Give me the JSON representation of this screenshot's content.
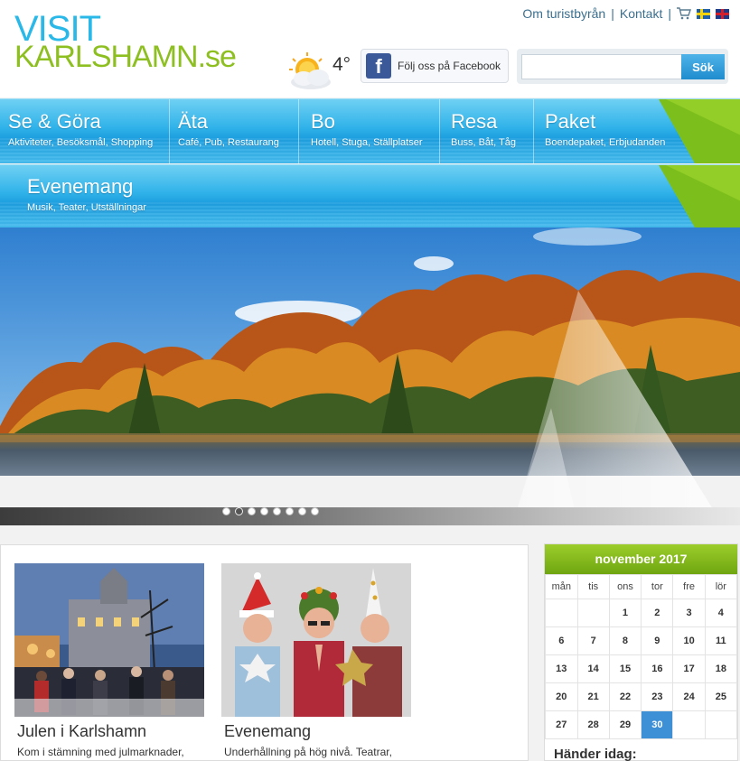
{
  "header": {
    "logo_line1": "VISIT",
    "logo_line2": "KARLSHAMN",
    "logo_tld": ".se",
    "links": [
      "Om turistbyrån",
      "Kontakt"
    ],
    "separator": "|",
    "temperature": "4°",
    "facebook_label": "Följ oss på Facebook",
    "facebook_letter": "f",
    "search_placeholder": "",
    "search_button": "Sök"
  },
  "nav": {
    "row1": [
      {
        "title": "Se & Göra",
        "sub": "Aktiviteter, Besöksmål, Shopping"
      },
      {
        "title": "Äta",
        "sub": "Café, Pub, Restaurang"
      },
      {
        "title": "Bo",
        "sub": "Hotell, Stuga, Ställplatser"
      },
      {
        "title": "Resa",
        "sub": "Buss, Båt, Tåg"
      },
      {
        "title": "Paket",
        "sub": "Boendepaket, Erbjudanden"
      }
    ],
    "row2": [
      {
        "title": "Evenemang",
        "sub": "Musik, Teater, Utställningar"
      }
    ]
  },
  "slider": {
    "dot_count": 8,
    "active_dot": 2
  },
  "cards": [
    {
      "title": "Julen i Karlshamn",
      "text": "Kom i stämning med julmarknader,"
    },
    {
      "title": "Evenemang",
      "text": "Underhållning på hög nivå. Teatrar,"
    }
  ],
  "calendar": {
    "month": "november 2017",
    "weekdays": [
      "mån",
      "tis",
      "ons",
      "tor",
      "fre",
      "lör"
    ],
    "weeks": [
      [
        "",
        "",
        "1",
        "2",
        "3",
        "4"
      ],
      [
        "6",
        "7",
        "8",
        "9",
        "10",
        "11"
      ],
      [
        "13",
        "14",
        "15",
        "16",
        "17",
        "18"
      ],
      [
        "20",
        "21",
        "22",
        "23",
        "24",
        "25"
      ],
      [
        "27",
        "28",
        "29",
        "30",
        "",
        ""
      ]
    ],
    "today": "30",
    "happening_label": "Händer idag:"
  },
  "colors": {
    "brand_blue": "#29b8e8",
    "brand_green": "#8dbf21",
    "nav_blue": "#2fb2e9",
    "calendar_green": "#7fb51a",
    "today_blue": "#3d8fd6"
  }
}
